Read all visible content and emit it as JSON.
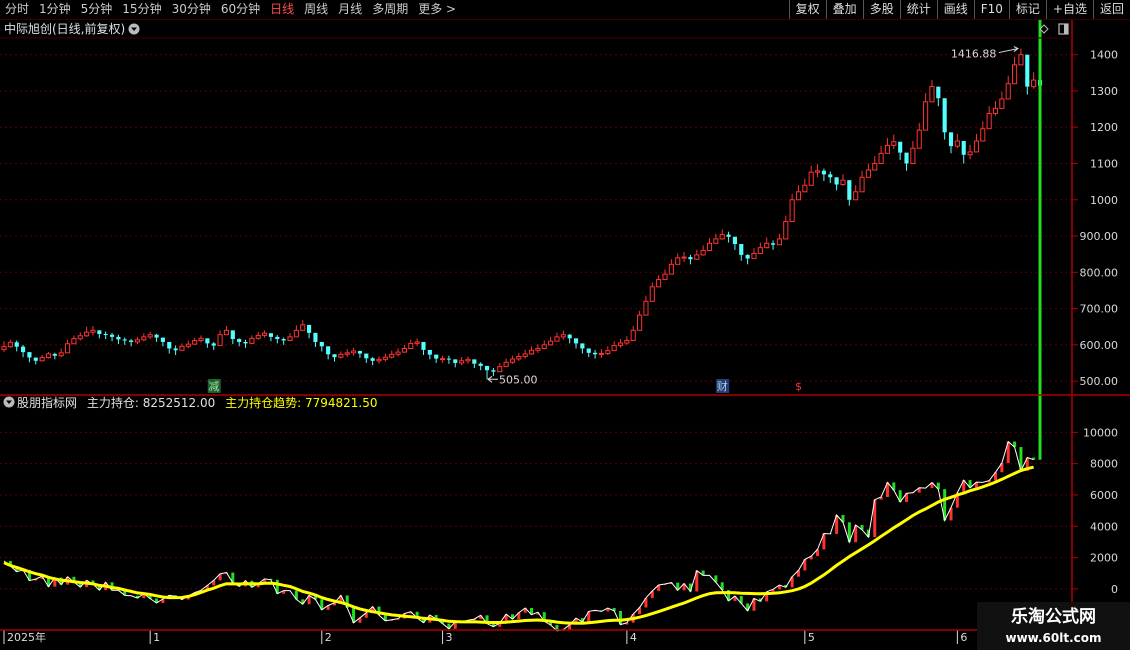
{
  "toolbar": {
    "periods": [
      {
        "label": "分时",
        "active": false
      },
      {
        "label": "1分钟",
        "active": false
      },
      {
        "label": "5分钟",
        "active": false
      },
      {
        "label": "15分钟",
        "active": false
      },
      {
        "label": "30分钟",
        "active": false
      },
      {
        "label": "60分钟",
        "active": false
      },
      {
        "label": "日线",
        "active": true
      },
      {
        "label": "周线",
        "active": false
      },
      {
        "label": "月线",
        "active": false
      },
      {
        "label": "多周期",
        "active": false
      },
      {
        "label": "更多 >",
        "active": false
      }
    ],
    "actions": [
      "复权",
      "叠加",
      "多股",
      "统计",
      "画线",
      "F10",
      "标记",
      "+自选",
      "返回"
    ]
  },
  "price_panel": {
    "title": "中际旭创(日线,前复权)",
    "high_label": "1416.88",
    "low_label": "505.00",
    "event_markers": [
      {
        "label": "减",
        "index": 33,
        "bg": "#1f5f2f",
        "fg": "#9fdfa0"
      },
      {
        "label": "财",
        "index": 113,
        "bg": "#1f3f6f",
        "fg": "#b0c8f0"
      },
      {
        "label": "$",
        "index": 125,
        "bg": "none",
        "fg": "#ff3030"
      }
    ]
  },
  "indicator_panel": {
    "source": "股朋指标网",
    "line1_name": "主力持仓",
    "line1_value": "8252512.00",
    "line2_name": "主力持仓趋势",
    "line2_value": "7794821.50"
  },
  "date_axis": [
    {
      "label": "2025年",
      "index": 0
    },
    {
      "label": "1",
      "index": 23
    },
    {
      "label": "2",
      "index": 50
    },
    {
      "label": "3",
      "index": 69
    },
    {
      "label": "4",
      "index": 98
    },
    {
      "label": "5",
      "index": 126
    },
    {
      "label": "6",
      "index": 150
    }
  ],
  "watermark": {
    "title": "乐淘公式网",
    "url": "www.60lt.com"
  },
  "colors": {
    "up": "#ff3232",
    "down": "#54ffff",
    "ma_line": "#ffff00",
    "main_line": "#ffffff",
    "grid": "#5a0000",
    "border": "#b00000"
  },
  "chart_data": [
    {
      "type": "candlestick",
      "title": "中际旭创(日线,前复权)",
      "y_ticks": [
        500,
        600,
        700,
        800,
        900,
        1000,
        1100,
        1200,
        1300,
        1400
      ],
      "y_tick_labels": [
        "500.00",
        "600.00",
        "700.00",
        "800.00",
        "900.00",
        "1000",
        "1100",
        "1200",
        "1300",
        "1400"
      ],
      "ylim": [
        470,
        1435
      ],
      "grid": true,
      "close": [
        595,
        607,
        595,
        580,
        565,
        556,
        565,
        575,
        570,
        578,
        603,
        617,
        625,
        635,
        640,
        630,
        628,
        622,
        615,
        612,
        608,
        614,
        622,
        628,
        620,
        608,
        590,
        585,
        596,
        602,
        612,
        618,
        604,
        598,
        628,
        640,
        616,
        608,
        604,
        618,
        626,
        632,
        622,
        616,
        612,
        622,
        640,
        655,
        633,
        608,
        596,
        574,
        566,
        574,
        578,
        583,
        576,
        563,
        556,
        560,
        566,
        574,
        580,
        590,
        604,
        608,
        586,
        573,
        562,
        562,
        560,
        550,
        556,
        560,
        548,
        542,
        530,
        526,
        540,
        552,
        561,
        568,
        575,
        585,
        590,
        600,
        610,
        622,
        628,
        618,
        604,
        590,
        578,
        574,
        576,
        584,
        598,
        605,
        612,
        640,
        682,
        720,
        760,
        780,
        795,
        822,
        840,
        842,
        836,
        848,
        860,
        880,
        892,
        904,
        898,
        878,
        848,
        838,
        852,
        868,
        880,
        876,
        892,
        940,
        1000,
        1022,
        1040,
        1076,
        1080,
        1070,
        1062,
        1042,
        1054,
        1000,
        1022,
        1062,
        1082,
        1100,
        1128,
        1150,
        1160,
        1130,
        1100,
        1142,
        1192,
        1270,
        1312,
        1280,
        1186,
        1148,
        1162,
        1124,
        1132,
        1162,
        1196,
        1238,
        1252,
        1278,
        1320,
        1372,
        1400,
        1312,
        1330,
        1315
      ],
      "wicks_high": [
        610,
        614,
        612,
        600,
        578,
        564,
        572,
        580,
        578,
        590,
        614,
        626,
        634,
        650,
        652,
        640,
        637,
        633,
        628,
        620,
        616,
        622,
        632,
        636,
        630,
        618,
        604,
        598,
        604,
        612,
        620,
        626,
        616,
        608,
        640,
        652,
        626,
        618,
        614,
        626,
        636,
        640,
        632,
        627,
        620,
        632,
        654,
        668,
        648,
        620,
        604,
        582,
        574,
        582,
        588,
        592,
        584,
        572,
        566,
        568,
        576,
        584,
        590,
        600,
        614,
        618,
        598,
        584,
        570,
        570,
        570,
        560,
        566,
        568,
        558,
        552,
        540,
        536,
        550,
        562,
        570,
        578,
        586,
        596,
        602,
        612,
        622,
        634,
        640,
        630,
        616,
        602,
        588,
        586,
        588,
        596,
        610,
        616,
        624,
        652,
        694,
        734,
        772,
        792,
        808,
        836,
        852,
        856,
        848,
        862,
        874,
        894,
        906,
        918,
        912,
        892,
        864,
        850,
        866,
        882,
        896,
        888,
        906,
        956,
        1016,
        1040,
        1058,
        1094,
        1098,
        1086,
        1078,
        1056,
        1070,
        1018,
        1040,
        1080,
        1100,
        1120,
        1148,
        1170,
        1180,
        1150,
        1120,
        1162,
        1212,
        1294,
        1330,
        1300,
        1210,
        1168,
        1182,
        1144,
        1152,
        1182,
        1216,
        1258,
        1272,
        1298,
        1342,
        1394,
        1416.88,
        1335,
        1352,
        1336
      ],
      "wicks_low": [
        580,
        592,
        582,
        566,
        552,
        546,
        554,
        562,
        560,
        566,
        590,
        604,
        612,
        622,
        626,
        618,
        616,
        610,
        602,
        600,
        596,
        602,
        610,
        616,
        608,
        596,
        576,
        572,
        584,
        590,
        600,
        606,
        592,
        586,
        616,
        628,
        602,
        596,
        592,
        606,
        614,
        620,
        610,
        604,
        600,
        610,
        626,
        640,
        618,
        594,
        582,
        560,
        554,
        562,
        566,
        570,
        564,
        550,
        544,
        548,
        554,
        562,
        568,
        578,
        592,
        596,
        572,
        560,
        550,
        550,
        548,
        538,
        544,
        548,
        536,
        530,
        505,
        514,
        528,
        540,
        548,
        556,
        562,
        572,
        578,
        588,
        598,
        610,
        614,
        604,
        590,
        576,
        566,
        562,
        564,
        572,
        586,
        592,
        600,
        628,
        668,
        706,
        746,
        766,
        780,
        808,
        826,
        828,
        822,
        834,
        846,
        866,
        878,
        890,
        882,
        862,
        832,
        822,
        838,
        854,
        866,
        862,
        876,
        922,
        984,
        1004,
        1024,
        1058,
        1062,
        1052,
        1046,
        1026,
        1038,
        984,
        1006,
        1046,
        1066,
        1084,
        1110,
        1132,
        1140,
        1110,
        1080,
        1122,
        1172,
        1250,
        1292,
        1258,
        1166,
        1128,
        1142,
        1100,
        1112,
        1142,
        1176,
        1218,
        1232,
        1258,
        1300,
        1352,
        1382,
        1290,
        1306,
        1290
      ],
      "series": [
        {
          "name": "主力持仓"
        },
        {
          "name": "主力持仓趋势"
        }
      ]
    },
    {
      "type": "line",
      "y_ticks": [
        0,
        2000,
        4000,
        6000,
        8000,
        10000
      ],
      "y_tick_labels": [
        "0",
        "2000",
        "4000",
        "6000",
        "8000",
        "10000"
      ],
      "ylim": [
        -2500,
        11300
      ],
      "grid": true,
      "series": [
        {
          "name": "主力持仓",
          "values": [
            1780,
            1460,
            1100,
            1210,
            530,
            630,
            810,
            140,
            720,
            270,
            770,
            440,
            110,
            540,
            310,
            -80,
            420,
            -90,
            -90,
            -420,
            -440,
            -590,
            -300,
            -620,
            -900,
            -650,
            -410,
            -480,
            -680,
            -450,
            -240,
            -90,
            220,
            540,
            960,
            1040,
            390,
            160,
            520,
            100,
            330,
            640,
            580,
            -310,
            -110,
            -110,
            -670,
            -980,
            -420,
            -670,
            -1340,
            -1060,
            -890,
            -420,
            -1210,
            -2170,
            -1850,
            -1520,
            -1130,
            -1680,
            -2040,
            -1970,
            -1900,
            -1580,
            -1460,
            -1860,
            -2160,
            -1670,
            -1920,
            -2220,
            -2550,
            -2100,
            -2110,
            -2000,
            -1930,
            -1690,
            -2220,
            -2420,
            -2190,
            -1620,
            -1930,
            -1520,
            -1220,
            -1650,
            -1490,
            -2070,
            -2310,
            -2680,
            -2600,
            -2290,
            -1870,
            -2110,
            -1440,
            -1370,
            -1440,
            -1220,
            -1410,
            -2280,
            -2160,
            -1610,
            -1190,
            -580,
            -130,
            250,
            310,
            400,
            -90,
            340,
            -170,
            1170,
            860,
            860,
            420,
            -70,
            -770,
            -460,
            -930,
            -1400,
            -610,
            -800,
            -190,
            -30,
            250,
            100,
            780,
            1180,
            1880,
            2090,
            2520,
            3540,
            3510,
            4720,
            4250,
            2980,
            4080,
            3780,
            3310,
            5700,
            5870,
            6800,
            6300,
            5550,
            6100,
            6150,
            6460,
            6440,
            6790,
            6370,
            4370,
            5190,
            6150,
            6950,
            6460,
            6820,
            6800,
            6920,
            7450,
            8040,
            9410,
            9060,
            7540,
            8390,
            8250
          ]
        },
        {
          "name": "主力持仓趋势",
          "values": [
            1680,
            1490,
            1370,
            1240,
            1090,
            970,
            880,
            740,
            640,
            560,
            510,
            460,
            410,
            370,
            320,
            220,
            180,
            90,
            30,
            -70,
            -160,
            -260,
            -300,
            -360,
            -440,
            -520,
            -560,
            -560,
            -550,
            -480,
            -370,
            -230,
            -80,
            40,
            200,
            330,
            320,
            310,
            330,
            330,
            320,
            360,
            370,
            320,
            230,
            150,
            0,
            -170,
            -270,
            -390,
            -560,
            -680,
            -780,
            -870,
            -990,
            -1150,
            -1280,
            -1380,
            -1460,
            -1530,
            -1600,
            -1660,
            -1700,
            -1750,
            -1780,
            -1820,
            -1880,
            -1920,
            -1960,
            -2010,
            -2070,
            -2090,
            -2110,
            -2110,
            -2100,
            -2120,
            -2140,
            -2150,
            -2150,
            -2130,
            -2090,
            -2060,
            -2020,
            -2000,
            -1990,
            -2020,
            -2060,
            -2120,
            -2170,
            -2190,
            -2190,
            -2200,
            -2160,
            -2120,
            -2080,
            -2030,
            -2010,
            -2000,
            -1960,
            -1900,
            -1810,
            -1710,
            -1580,
            -1450,
            -1310,
            -1170,
            -1040,
            -900,
            -740,
            -580,
            -430,
            -310,
            -250,
            -240,
            -240,
            -250,
            -280,
            -290,
            -300,
            -310,
            -300,
            -280,
            -250,
            -190,
            -120,
            0,
            150,
            370,
            630,
            890,
            1190,
            1500,
            1780,
            2060,
            2310,
            2560,
            2810,
            3080,
            3360,
            3630,
            3900,
            4160,
            4410,
            4690,
            4920,
            5110,
            5330,
            5550,
            5720,
            5850,
            6000,
            6120,
            6270,
            6380,
            6520,
            6660,
            6820,
            7000,
            7190,
            7380,
            7560,
            7680,
            7780
          ]
        }
      ]
    }
  ]
}
